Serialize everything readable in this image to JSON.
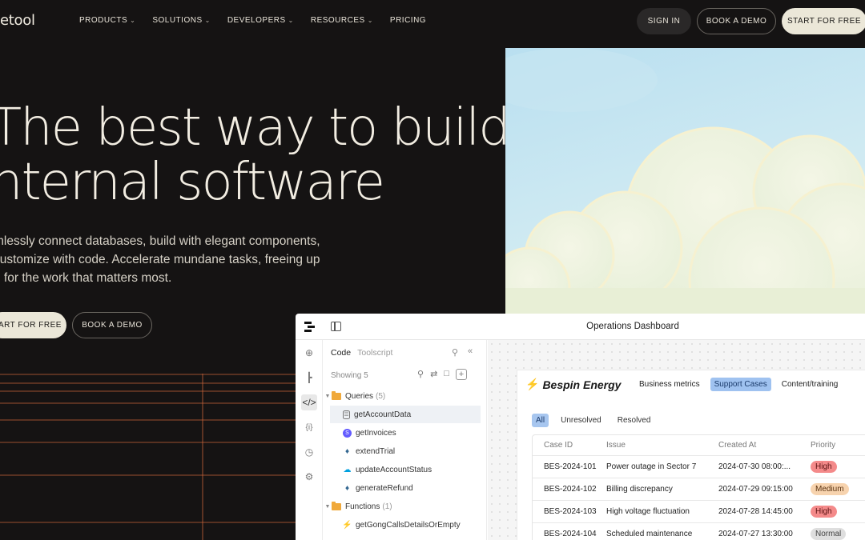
{
  "nav": {
    "logo": "etool",
    "menu": [
      {
        "label": "PRODUCTS",
        "chevron": true
      },
      {
        "label": "SOLUTIONS",
        "chevron": true
      },
      {
        "label": "DEVELOPERS",
        "chevron": true
      },
      {
        "label": "RESOURCES",
        "chevron": true
      },
      {
        "label": "PRICING",
        "chevron": false
      }
    ],
    "sign_in": "SIGN IN",
    "book_demo": "BOOK A DEMO",
    "start_free": "START FOR FREE"
  },
  "hero": {
    "title_line1": "The best way to build",
    "title_line2": "nternal software",
    "subtitle_line1": "mlessly connect databases, build with elegant components,",
    "subtitle_line2": "customize with code. Accelerate mundane tasks, freeing up",
    "subtitle_line3": "e for the work that matters most.",
    "cta_primary": "TART FOR FREE",
    "cta_secondary": "BOOK A DEMO"
  },
  "app": {
    "window_title": "Operations Dashboard",
    "rail_icons": [
      "add-circle-icon",
      "tree-icon",
      "code-icon",
      "variable-icon",
      "history-icon",
      "gear-icon"
    ],
    "code_panel": {
      "tabs": [
        "Code",
        "Toolscript"
      ],
      "showing": "Showing 5",
      "queries_label": "Queries",
      "queries_count": "(5)",
      "queries": [
        {
          "name": "getAccountData",
          "icon": "database-icon"
        },
        {
          "name": "getInvoices",
          "icon": "stripe-icon"
        },
        {
          "name": "extendTrial",
          "icon": "postgres-icon"
        },
        {
          "name": "updateAccountStatus",
          "icon": "salesforce-icon"
        },
        {
          "name": "generateRefund",
          "icon": "postgres-icon"
        }
      ],
      "functions_label": "Functions",
      "functions_count": "(1)",
      "functions": [
        {
          "name": "getGongCallsDetailsOrEmpty",
          "icon": "function-icon"
        }
      ]
    },
    "dashboard": {
      "brand": "Bespin Energy",
      "tabs": [
        "Business metrics",
        "Support Cases",
        "Content/training"
      ],
      "active_tab": "Support Cases",
      "filters": [
        "All",
        "Unresolved",
        "Resolved"
      ],
      "table": {
        "headers": [
          "Case ID",
          "Issue",
          "Created At",
          "Priority"
        ],
        "rows": [
          {
            "id": "BES-2024-101",
            "issue": "Power outage in Sector 7",
            "created": "2024-07-30 08:00:...",
            "priority": "High"
          },
          {
            "id": "BES-2024-102",
            "issue": "Billing discrepancy",
            "created": "2024-07-29 09:15:00",
            "priority": "Medium"
          },
          {
            "id": "BES-2024-103",
            "issue": "High voltage fluctuation",
            "created": "2024-07-28 14:45:00",
            "priority": "High"
          },
          {
            "id": "BES-2024-104",
            "issue": "Scheduled maintenance",
            "created": "2024-07-27 13:30:00",
            "priority": "Normal"
          }
        ]
      }
    }
  }
}
